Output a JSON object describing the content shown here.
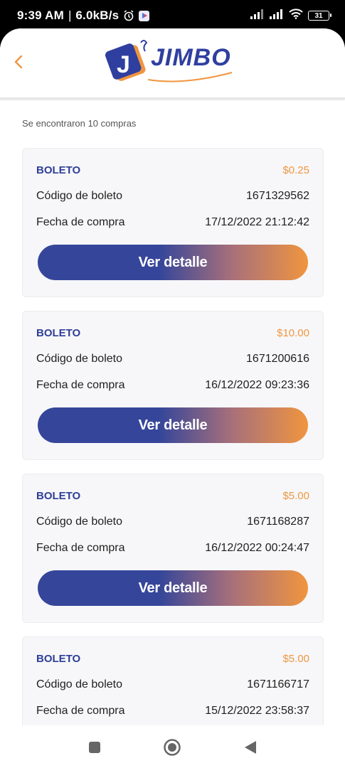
{
  "status_bar": {
    "time": "9:39 AM",
    "speed": "6.0kB/s",
    "battery": "31",
    "icons": [
      "alarm-icon",
      "play-store-icon",
      "signal-icon",
      "signal-icon",
      "wifi-icon",
      "battery-icon"
    ]
  },
  "header": {
    "back_icon": "chevron-left-icon",
    "logo_text": "JIMBO",
    "logo_colors": {
      "blue": "#2f3fa0",
      "orange": "#f0953f"
    }
  },
  "results": {
    "summary": "Se encontraron 10 compras"
  },
  "labels": {
    "code": "Código de boleto",
    "date": "Fecha de compra",
    "button": "Ver detalle"
  },
  "purchases": [
    {
      "type": "BOLETO",
      "price": "$0.25",
      "code": "1671329562",
      "date": "17/12/2022 21:12:42"
    },
    {
      "type": "BOLETO",
      "price": "$10.00",
      "code": "1671200616",
      "date": "16/12/2022 09:23:36"
    },
    {
      "type": "BOLETO",
      "price": "$5.00",
      "code": "1671168287",
      "date": "16/12/2022 00:24:47"
    },
    {
      "type": "BOLETO",
      "price": "$5.00",
      "code": "1671166717",
      "date": "15/12/2022 23:58:37"
    }
  ],
  "colors": {
    "primary": "#35469a",
    "accent": "#f0953f",
    "card_bg": "#f7f7f9"
  },
  "nav_bar": {
    "icons": [
      "recents-square-icon",
      "home-circle-icon",
      "back-triangle-icon"
    ]
  }
}
